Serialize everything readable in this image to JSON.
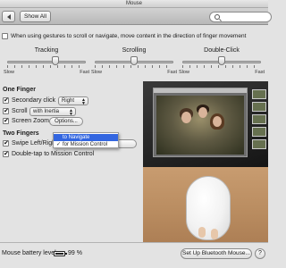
{
  "window": {
    "title": "Mouse"
  },
  "toolbar": {
    "show_all_label": "Show All",
    "search_value": ""
  },
  "gesture_option": {
    "label": "When using gestures to scroll or navigate, move content in the direction of finger movement",
    "checked": false
  },
  "sliders": [
    {
      "title": "Tracking",
      "min_label": "Slow",
      "max_label": "Fast",
      "level": 0.62
    },
    {
      "title": "Scrolling",
      "min_label": "Slow",
      "max_label": "Fast",
      "level": 0.5
    },
    {
      "title": "Double-Click",
      "min_label": "Slow",
      "max_label": "Fast",
      "level": 0.5
    }
  ],
  "one_finger": {
    "header": "One Finger",
    "secondary_click": {
      "label": "Secondary click",
      "checked": true,
      "value": "Right"
    },
    "scroll": {
      "label": "Scroll",
      "checked": true,
      "value": "with Inertia"
    },
    "screen_zoom": {
      "label": "Screen Zoom",
      "checked": true,
      "button_label": "Options..."
    }
  },
  "two_fingers": {
    "header": "Two Fingers",
    "swipe": {
      "label": "Swipe Left/Righ",
      "checked": true
    },
    "double_tap": {
      "label": "Double-tap to Mission Control",
      "checked": true
    }
  },
  "swipe_menu": {
    "items": [
      {
        "label": "to Navigate",
        "highlighted": true,
        "checked": false
      },
      {
        "label": "for Mission Control",
        "highlighted": false,
        "checked": true,
        "check_mark": "✓"
      }
    ]
  },
  "footer": {
    "battery_label": "Mouse battery level:",
    "battery_value": "99 %",
    "bluetooth_button": "Set Up Bluetooth Mouse...",
    "help_label": "?"
  },
  "colors": {
    "menu_highlight": "#3366e0",
    "window_bg": "#e3e3e3"
  }
}
